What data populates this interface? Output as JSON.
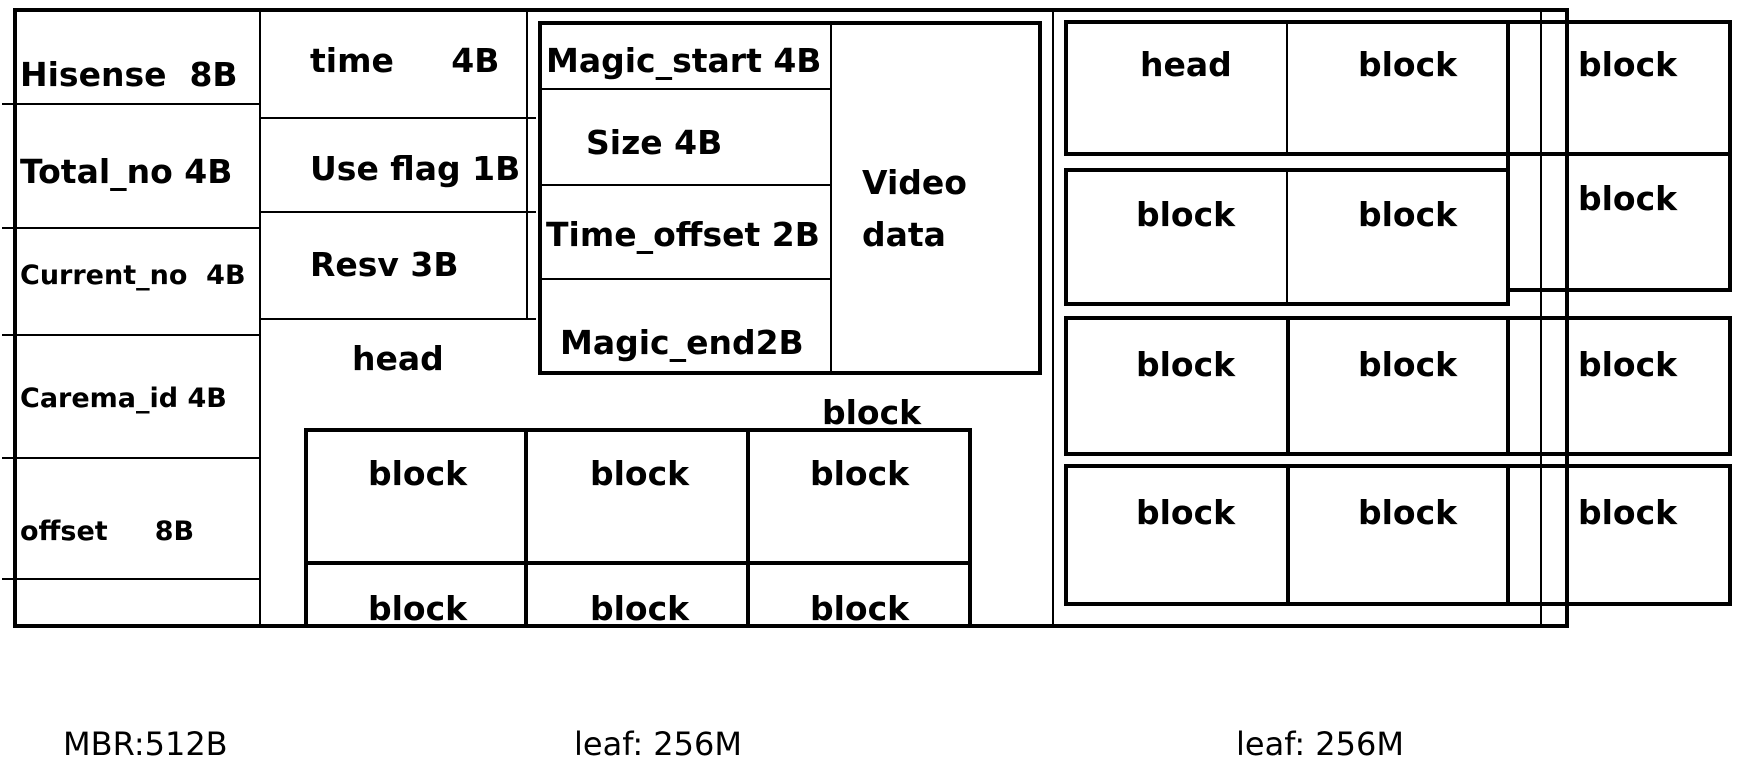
{
  "diagram": {
    "mbr": {
      "fields": [
        {
          "name": "Hisense",
          "size": "8B",
          "label": "Hisense  8B"
        },
        {
          "name": "Total_no",
          "size": "4B",
          "label": "Total_no 4B"
        },
        {
          "name": "Current_no",
          "size": "4B",
          "label": "Current_no  4B"
        },
        {
          "name": "Carema_id",
          "size": "4B",
          "label": "Carema_id 4B"
        },
        {
          "name": "offset",
          "size": "8B",
          "label": "offset     8B"
        },
        {
          "name": "",
          "size": "",
          "label": ""
        }
      ],
      "caption": "MBR:512B"
    },
    "leaf1": {
      "head_fields": [
        {
          "label": "time     4B"
        },
        {
          "label": "Use flag 1B"
        },
        {
          "label": "Resv 3B"
        }
      ],
      "head_label": "head",
      "block_detail": {
        "fields": [
          {
            "label": "Magic_start 4B"
          },
          {
            "label": "Size 4B"
          },
          {
            "label": "Time_offset 2B"
          },
          {
            "label": "Magic_end2B"
          }
        ],
        "video_label_line1": "Video",
        "video_label_line2": "data",
        "block_label": "block"
      },
      "blocks": [
        "block",
        "block",
        "block",
        "block",
        "block",
        "block"
      ],
      "caption": "leaf: 256M"
    },
    "leaf2": {
      "rows": [
        [
          "head",
          "block",
          "block"
        ],
        [
          "block",
          "block",
          "block"
        ],
        [
          "block",
          "block",
          "block"
        ],
        [
          "block",
          "block",
          "block"
        ]
      ],
      "caption": "leaf: 256M"
    }
  }
}
